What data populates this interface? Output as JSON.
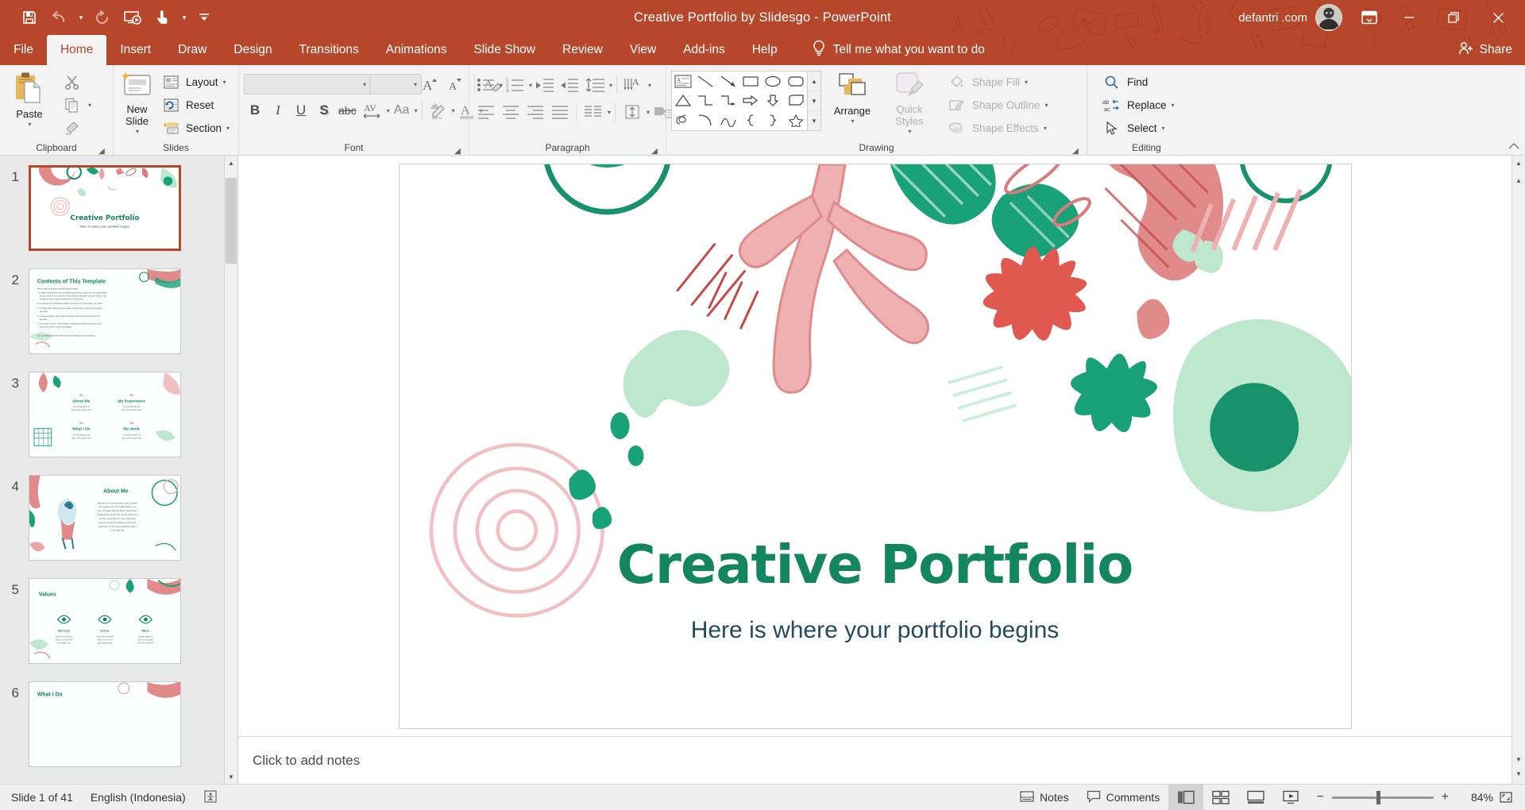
{
  "titlebar": {
    "quick_access": [
      {
        "name": "save-icon",
        "label": "Save"
      },
      {
        "name": "undo-icon",
        "label": "Undo"
      },
      {
        "name": "redo-icon",
        "label": "Redo"
      },
      {
        "name": "start-presentation-icon",
        "label": "Start From Beginning"
      },
      {
        "name": "touch-mode-icon",
        "label": "Touch/Mouse Mode"
      },
      {
        "name": "customize-qat-icon",
        "label": "Customize Quick Access Toolbar"
      }
    ],
    "document_title": "Creative Portfolio by Slidesgo  -  PowerPoint",
    "account_name": "defantri .com",
    "ribbon_display_options": "Ribbon Display Options",
    "minimize": "Minimize",
    "restore": "Restore Down",
    "close": "Close"
  },
  "tabs": [
    {
      "label": "File",
      "active": false
    },
    {
      "label": "Home",
      "active": true
    },
    {
      "label": "Insert",
      "active": false
    },
    {
      "label": "Draw",
      "active": false
    },
    {
      "label": "Design",
      "active": false
    },
    {
      "label": "Transitions",
      "active": false
    },
    {
      "label": "Animations",
      "active": false
    },
    {
      "label": "Slide Show",
      "active": false
    },
    {
      "label": "Review",
      "active": false
    },
    {
      "label": "View",
      "active": false
    },
    {
      "label": "Add-ins",
      "active": false
    },
    {
      "label": "Help",
      "active": false
    }
  ],
  "tell_me": "Tell me what you want to do",
  "share": "Share",
  "ribbon": {
    "groups": [
      {
        "name": "Clipboard"
      },
      {
        "name": "Slides"
      },
      {
        "name": "Font"
      },
      {
        "name": "Paragraph"
      },
      {
        "name": "Drawing"
      },
      {
        "name": "Editing"
      }
    ],
    "clipboard": {
      "paste": "Paste",
      "cut": "Cut",
      "copy": "Copy",
      "format_painter": "Format Painter",
      "label": "Clipboard"
    },
    "slides": {
      "new_slide": "New\nSlide",
      "new_slide_line1": "New",
      "new_slide_line2": "Slide",
      "layout": "Layout",
      "reset": "Reset",
      "section": "Section",
      "label": "Slides"
    },
    "font": {
      "font_name": "",
      "font_size": "",
      "bold": "B",
      "italic": "I",
      "underline": "U",
      "shadow": "S",
      "strikethrough": "abc",
      "char_spacing": "AV",
      "change_case": "Aa",
      "increase_size": "A",
      "decrease_size": "A",
      "clear_formatting": "Clear All Formatting",
      "highlight": "Text Highlight Color",
      "font_color": "A",
      "label": "Font"
    },
    "paragraph": {
      "bullets": "Bullets",
      "numbering": "Numbering",
      "decrease_indent": "Decrease Indent",
      "increase_indent": "Increase Indent",
      "line_spacing": "Line Spacing",
      "text_direction": "Text Direction",
      "align_text": "Align Text",
      "convert_smartart": "Convert to SmartArt",
      "align_left": "Align Left",
      "align_center": "Center",
      "align_right": "Align Right",
      "justify": "Justify",
      "columns": "Columns",
      "label": "Paragraph"
    },
    "drawing": {
      "shapes": [
        "text-box",
        "line",
        "arrow",
        "rectangle",
        "oval",
        "rounded-rectangle",
        "triangle",
        "elbow-connector",
        "elbow-arrow-connector",
        "right-arrow",
        "down-arrow",
        "flowchart-shape",
        "scribble",
        "arc",
        "curve",
        "left-brace",
        "right-brace",
        "star"
      ],
      "arrange": "Arrange",
      "quick_styles_line1": "Quick",
      "quick_styles_line2": "Styles",
      "shape_fill": "Shape Fill",
      "shape_outline": "Shape Outline",
      "shape_effects": "Shape Effects",
      "label": "Drawing"
    },
    "editing": {
      "find": "Find",
      "replace": "Replace",
      "select": "Select",
      "label": "Editing"
    }
  },
  "thumbnails": [
    {
      "num": "1",
      "title": "Creative Portfolio",
      "subtitle": "Here is where your portfolio begins",
      "selected": true,
      "kind": "title"
    },
    {
      "num": "2",
      "title": "Contents of This Template",
      "selected": false,
      "kind": "contents"
    },
    {
      "num": "3",
      "title": "",
      "selected": false,
      "kind": "foursection"
    },
    {
      "num": "4",
      "title": "About Me",
      "selected": false,
      "kind": "aboutme"
    },
    {
      "num": "5",
      "title": "Values",
      "selected": false,
      "kind": "values"
    },
    {
      "num": "6",
      "title": "What I Do",
      "selected": false,
      "kind": "whatido"
    }
  ],
  "slide": {
    "title": "Creative Portfolio",
    "subtitle": "Here is where your portfolio begins",
    "title_color": "#14865f",
    "subtitle_color": "#234a5e",
    "accent_pink": "#e28a8a",
    "accent_green": "#1c9e74",
    "accent_mint": "#b7e8c9"
  },
  "notes_placeholder": "Click to add notes",
  "statusbar": {
    "slide_indicator": "Slide 1 of 41",
    "language": "English (Indonesia)",
    "accessibility": "Accessibility Checker",
    "notes": "Notes",
    "comments": "Comments",
    "views": [
      {
        "name": "normal-view",
        "label": "Normal",
        "active": true
      },
      {
        "name": "slide-sorter-view",
        "label": "Slide Sorter",
        "active": false
      },
      {
        "name": "reading-view",
        "label": "Reading View",
        "active": false
      },
      {
        "name": "slide-show-view",
        "label": "Slide Show",
        "active": false
      }
    ],
    "zoom_out": "Zoom Out",
    "zoom_in": "Zoom In",
    "zoom_level": "84%",
    "fit_to_window": "Fit slide to current window"
  }
}
